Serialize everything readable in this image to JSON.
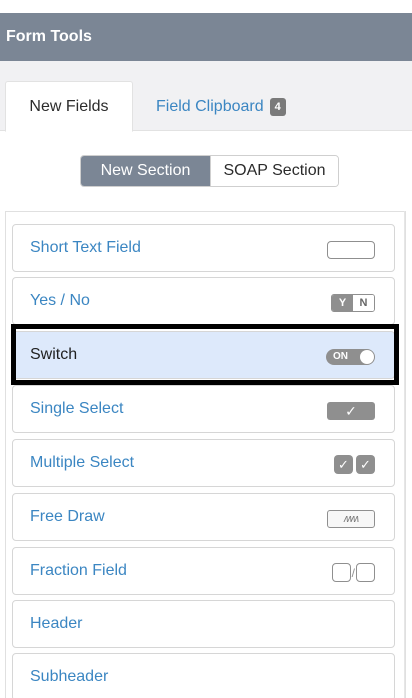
{
  "header": {
    "title": "Form Tools"
  },
  "tabs": [
    {
      "label": "New Fields"
    },
    {
      "label": "Field Clipboard",
      "badge": "4"
    }
  ],
  "section_toggle": {
    "options": [
      "New Section",
      "SOAP Section"
    ],
    "selected": "New Section"
  },
  "fields": [
    {
      "label": "Short Text Field",
      "icon": "text-input-icon"
    },
    {
      "label": "Yes / No",
      "icon": "yes-no-icon",
      "icon_text": [
        "Y",
        "N"
      ]
    },
    {
      "label": "Switch",
      "icon": "switch-icon",
      "icon_text": "ON",
      "selected": true
    },
    {
      "label": "Single Select",
      "icon": "single-check-icon",
      "icon_text": "✓"
    },
    {
      "label": "Multiple Select",
      "icon": "multiple-check-icon",
      "icon_text": "✓"
    },
    {
      "label": "Free Draw",
      "icon": "free-draw-icon",
      "icon_text": "ʍʍ"
    },
    {
      "label": "Fraction Field",
      "icon": "fraction-icon",
      "icon_text": "/"
    },
    {
      "label": "Header"
    },
    {
      "label": "Subheader"
    }
  ],
  "colors": {
    "header_bg": "#7b8695",
    "link": "#3b86c2",
    "selected_bg": "#dde9fb",
    "icon_gray": "#8f8f8f"
  }
}
